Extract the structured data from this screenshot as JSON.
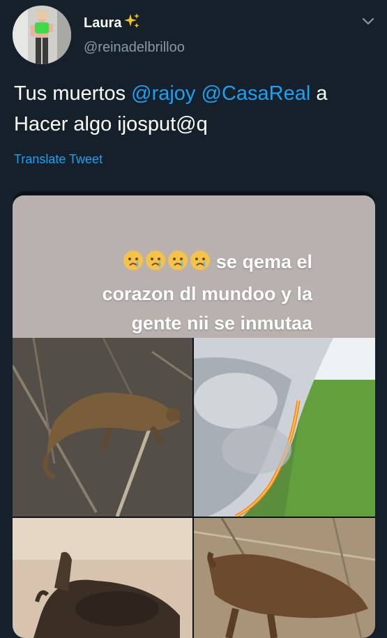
{
  "tweet": {
    "display_name": "Laura",
    "handle": "@reinadelbrilloo",
    "text_part1": "Tus muertos ",
    "mention1": "@rajoy",
    "text_part2": " ",
    "mention2": "@CasaReal",
    "text_part3": "  a Hacer algo ijosput@q",
    "translate_label": "Translate Tweet"
  },
  "media": {
    "caption_line1": "se qema el",
    "caption_line2": "corazon dl mundoo y la",
    "caption_line3": "gente nii se inmutaa",
    "emoji_icon": "crying-face-icon",
    "photos": [
      "burned-anteater-photo",
      "forest-fire-smoke-photo",
      "burned-rabbit-photo",
      "burned-deer-photo"
    ]
  },
  "colors": {
    "background": "#15202b",
    "link": "#1da1f2",
    "secondary_text": "#8899a6"
  }
}
